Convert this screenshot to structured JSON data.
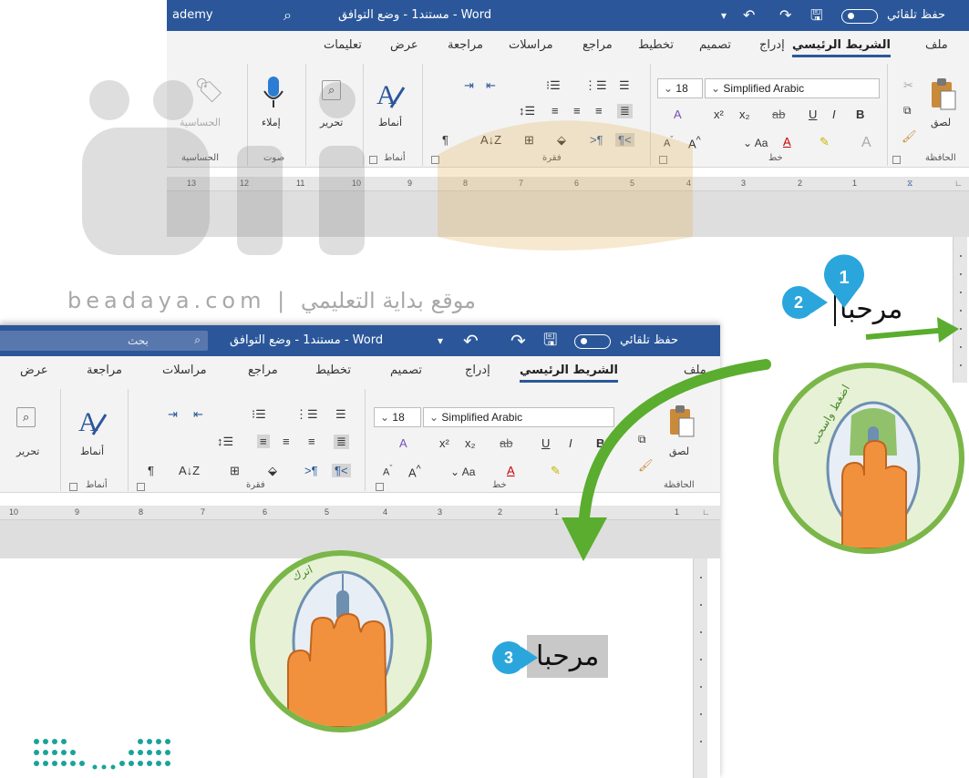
{
  "window_top": {
    "title": {
      "autosave_label": "حفظ تلقائي",
      "doc_name": "مستند1 - وضع التوافق - Word",
      "app_fragment": "ademy"
    },
    "tabs": [
      "ملف",
      "الشريط الرئيسي",
      "إدراج",
      "تصميم",
      "تخطيط",
      "مراجع",
      "مراسلات",
      "مراجعة",
      "عرض",
      "تعليمات"
    ],
    "active_tab": "الشريط الرئيسي",
    "ribbon": {
      "paste_label": "لصق",
      "font_name": "Simplified Arabic",
      "font_size": "18",
      "change_case": "Aa",
      "styles_label": "أنماط",
      "editing_label": "تحرير",
      "dictate_label": "إملاء",
      "sensitivity_label": "الحساسية",
      "group_clipboard": "الحافظة",
      "group_font": "خط",
      "group_paragraph": "فقرة",
      "group_styles": "أنماط",
      "group_voice": "صوت",
      "group_sensitivity": "الحساسية"
    },
    "ruler_numbers": [
      "13",
      "12",
      "11",
      "10",
      "9",
      "8",
      "7",
      "6",
      "5",
      "4",
      "3",
      "2",
      "1"
    ],
    "document_text": "مرحبا"
  },
  "window_bottom": {
    "title": {
      "autosave_label": "حفظ تلقائي",
      "doc_name": "مستند1 - وضع التوافق - Word",
      "search_placeholder": "بحث"
    },
    "tabs": [
      "ملف",
      "الشريط الرئيسي",
      "إدراج",
      "تصميم",
      "تخطيط",
      "مراجع",
      "مراسلات",
      "مراجعة",
      "عرض"
    ],
    "active_tab": "الشريط الرئيسي",
    "ribbon": {
      "paste_label": "لصق",
      "font_name": "Simplified Arabic",
      "font_size": "18",
      "change_case": "Aa",
      "styles_label": "أنماط",
      "editing_label": "تحرير",
      "group_clipboard": "الحافظة",
      "group_font": "خط",
      "group_paragraph": "فقرة",
      "group_styles": "أنماط"
    },
    "ruler_numbers": [
      "10",
      "9",
      "8",
      "7",
      "6",
      "5",
      "4",
      "3",
      "2",
      "1",
      "1"
    ],
    "document_text": "مرحبا"
  },
  "steps": {
    "step1": "1",
    "step2": "2",
    "step3": "3"
  },
  "circles": {
    "top_caption": "اضغط واسحب",
    "bottom_caption": "اترك"
  },
  "watermark": {
    "site": "beadaya.com",
    "tagline": "موقع بداية التعليمي",
    "separator": "|"
  },
  "colors": {
    "word_blue": "#2b579a",
    "ribbon_bg": "#f3f3f3",
    "badge_blue": "#2aa6dc",
    "arrow_green": "#5aad2e",
    "circle_ring": "#7ab648",
    "hand_orange": "#f2913d"
  }
}
